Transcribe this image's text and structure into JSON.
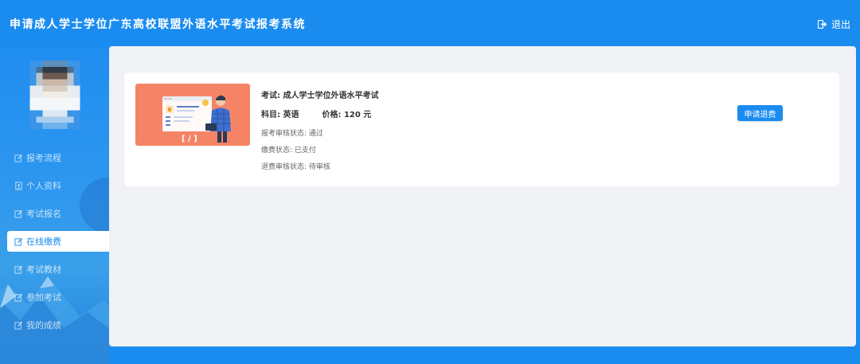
{
  "header": {
    "title": "申请成人学士学位广东高校联盟外语水平考试报考系统",
    "logout_label": "退出"
  },
  "sidebar": {
    "items": [
      {
        "label": "报考流程",
        "icon": "edit-icon",
        "active": false
      },
      {
        "label": "个人资料",
        "icon": "id-card-icon",
        "active": false
      },
      {
        "label": "考试报名",
        "icon": "edit-icon",
        "active": false
      },
      {
        "label": "在线缴费",
        "icon": "edit-icon",
        "active": true
      },
      {
        "label": "考试教材",
        "icon": "edit-icon",
        "active": false
      },
      {
        "label": "参加考试",
        "icon": "edit-icon",
        "active": false
      },
      {
        "label": "我的成绩",
        "icon": "edit-icon",
        "active": false
      }
    ]
  },
  "order": {
    "exam_label": "考试:",
    "exam_name": "成人学士学位外语水平考试",
    "subject_label": "科目:",
    "subject": "英语",
    "price_label": "价格:",
    "price": "120 元",
    "review_status_label": "报考审核状态:",
    "review_status": "通过",
    "payment_status_label": "缴费状态:",
    "payment_status": "已支付",
    "refund_status_label": "退费审核状态:",
    "refund_status": "待审核",
    "refund_button": "申请退费"
  },
  "colors": {
    "primary": "#1a8cf0",
    "thumb_bg": "#f58466",
    "content_bg": "#f0f2f5"
  }
}
